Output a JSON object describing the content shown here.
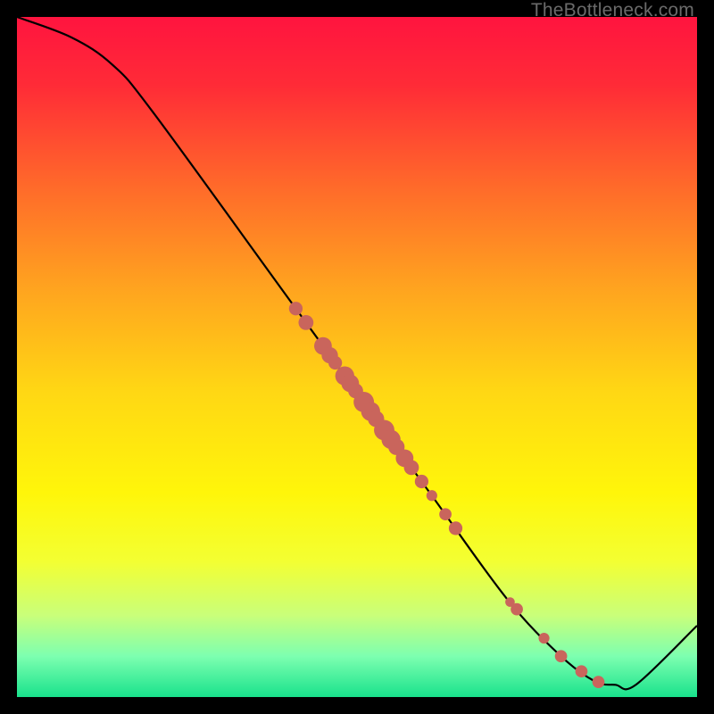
{
  "watermark": "TheBottleneck.com",
  "chart_data": {
    "type": "line",
    "title": "",
    "xlabel": "",
    "ylabel": "",
    "xlim": [
      0,
      100
    ],
    "ylim": [
      0,
      100
    ],
    "background": "rainbow-vertical-gradient",
    "curve": [
      {
        "x": 0,
        "y": 100
      },
      {
        "x": 8,
        "y": 97
      },
      {
        "x": 14,
        "y": 93
      },
      {
        "x": 20,
        "y": 86
      },
      {
        "x": 40,
        "y": 58.5
      },
      {
        "x": 60,
        "y": 31
      },
      {
        "x": 72,
        "y": 14.5
      },
      {
        "x": 80,
        "y": 6
      },
      {
        "x": 85,
        "y": 2.3
      },
      {
        "x": 88,
        "y": 1.8
      },
      {
        "x": 91,
        "y": 1.8
      },
      {
        "x": 100,
        "y": 10.5
      }
    ],
    "points_on_curve": [
      {
        "x": 41.0,
        "r": 1.0
      },
      {
        "x": 42.5,
        "r": 1.1
      },
      {
        "x": 45.0,
        "r": 1.3
      },
      {
        "x": 46.0,
        "r": 1.2
      },
      {
        "x": 46.8,
        "r": 1.0
      },
      {
        "x": 48.2,
        "r": 1.4
      },
      {
        "x": 49.0,
        "r": 1.3
      },
      {
        "x": 49.8,
        "r": 1.1
      },
      {
        "x": 51.0,
        "r": 1.5
      },
      {
        "x": 52.0,
        "r": 1.4
      },
      {
        "x": 52.8,
        "r": 1.2
      },
      {
        "x": 54.0,
        "r": 1.5
      },
      {
        "x": 55.0,
        "r": 1.4
      },
      {
        "x": 55.8,
        "r": 1.2
      },
      {
        "x": 57.0,
        "r": 1.3
      },
      {
        "x": 58.0,
        "r": 1.1
      },
      {
        "x": 59.5,
        "r": 1.0
      },
      {
        "x": 61.0,
        "r": 0.8
      },
      {
        "x": 63.0,
        "r": 0.9
      },
      {
        "x": 64.5,
        "r": 1.0
      },
      {
        "x": 72.5,
        "r": 0.7
      },
      {
        "x": 73.5,
        "r": 0.9
      },
      {
        "x": 77.5,
        "r": 0.8
      },
      {
        "x": 80.0,
        "r": 0.9
      },
      {
        "x": 83.0,
        "r": 0.9
      },
      {
        "x": 85.5,
        "r": 0.9
      }
    ],
    "gradient_stops": [
      {
        "offset": 0.0,
        "color": "#ff143f"
      },
      {
        "offset": 0.1,
        "color": "#ff2b37"
      },
      {
        "offset": 0.25,
        "color": "#ff6a2a"
      },
      {
        "offset": 0.4,
        "color": "#ffa41f"
      },
      {
        "offset": 0.55,
        "color": "#ffd714"
      },
      {
        "offset": 0.7,
        "color": "#fff60a"
      },
      {
        "offset": 0.8,
        "color": "#f3ff32"
      },
      {
        "offset": 0.88,
        "color": "#c9ff7a"
      },
      {
        "offset": 0.94,
        "color": "#7dffb0"
      },
      {
        "offset": 1.0,
        "color": "#19e28c"
      }
    ],
    "point_color": "#c9655c",
    "curve_color": "#000000"
  }
}
